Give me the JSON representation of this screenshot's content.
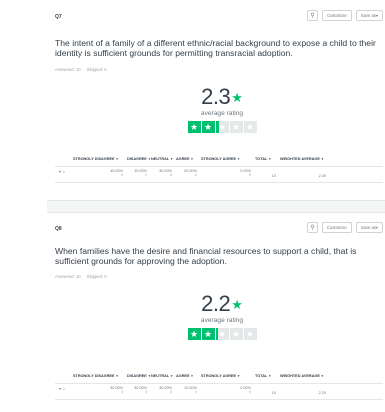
{
  "questions": [
    {
      "number": "Q7",
      "text": "The intent of a family of a different ethnic/racial background to expose a child to their identity is sufficient grounds for permitting transracial adoption.",
      "answered": "Answered: 10",
      "skipped": "Skipped: 0",
      "rating": "2.3",
      "rating_label": "average rating",
      "stars_value": 2.3,
      "actions": {
        "customize": "Customize",
        "save_as": "Save as▾"
      },
      "headers": [
        "",
        "STRONGLY DISAGREE",
        "DISAGREE",
        "NEUTRAL",
        "AGREE",
        "STRONGLY AGREE",
        "TOTAL",
        "WEIGHTED AVERAGE"
      ],
      "row": {
        "label": "☆",
        "cells": [
          {
            "pct": "40.00%",
            "count": "4"
          },
          {
            "pct": "10.00%",
            "count": "1"
          },
          {
            "pct": "30.00%",
            "count": "3"
          },
          {
            "pct": "20.00%",
            "count": "2"
          },
          {
            "pct": "0.00%",
            "count": "0"
          }
        ],
        "total": "10",
        "weighted": "2.30"
      }
    },
    {
      "number": "Q8",
      "text": "When families have the desire and financial resources to support a child, that is sufficient grounds for approving the adoption.",
      "answered": "Answered: 10",
      "skipped": "Skipped: 0",
      "rating": "2.2",
      "rating_label": "average rating",
      "stars_value": 2.2,
      "actions": {
        "customize": "Customize",
        "save_as": "Save as▾"
      },
      "headers": [
        "",
        "STRONGLY DISAGREE",
        "DISAGREE",
        "NEUTRAL",
        "AGREE",
        "STRONGLY AGREE",
        "TOTAL",
        "WEIGHTED AVERAGE"
      ],
      "row": {
        "label": "☆",
        "cells": [
          {
            "pct": "30.00%",
            "count": "3"
          },
          {
            "pct": "30.00%",
            "count": "3"
          },
          {
            "pct": "30.00%",
            "count": "3"
          },
          {
            "pct": "10.00%",
            "count": "1"
          },
          {
            "pct": "0.00%",
            "count": "0"
          }
        ],
        "total": "10",
        "weighted": "2.20"
      }
    }
  ],
  "icons": {
    "lightbulb": "lightbulb-icon",
    "star": "star-icon",
    "expand": "expand-caret-icon"
  },
  "colors": {
    "accent": "#00bf6f",
    "empty_star": "#e5e8e9",
    "text": "#333e48",
    "muted": "#6b787f"
  }
}
